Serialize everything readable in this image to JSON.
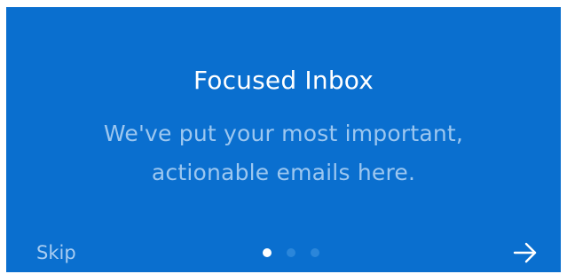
{
  "onboarding": {
    "title": "Focused Inbox",
    "body_line_1": "We've put your most important,",
    "body_line_2": "actionable emails here.",
    "skip_label": "Skip",
    "pager": {
      "total_pages": 3,
      "current_page": 1
    },
    "next_icon": "arrow-right-icon"
  },
  "colors": {
    "background": "#0a6fcf",
    "title_text": "#ffffff",
    "body_text": "#9cc7f0",
    "dot_active": "#ffffff",
    "dot_inactive": "#2b86da"
  }
}
